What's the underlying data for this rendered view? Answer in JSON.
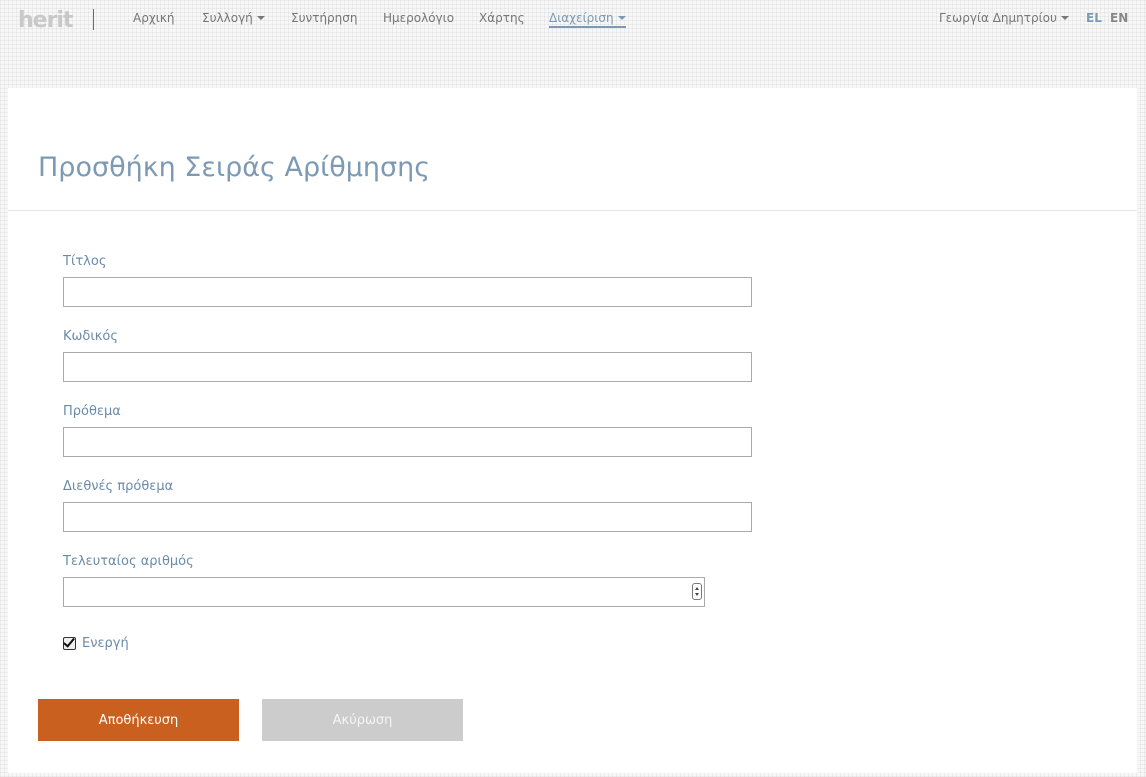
{
  "nav": {
    "logo_text": "herit",
    "items": [
      {
        "label": "Αρχική"
      },
      {
        "label": "Συλλογή"
      },
      {
        "label": "Συντήρηση"
      },
      {
        "label": "Ημερολόγιο"
      },
      {
        "label": "Χάρτης"
      },
      {
        "label": "Διαχείριση"
      }
    ],
    "active_item": "Διαχείριση",
    "user_name": "Γεωργία Δημητρίου",
    "languages": [
      "EL",
      "EN"
    ],
    "active_language": "EL"
  },
  "page": {
    "title": "Προσθήκη Σειράς Αρίθμησης"
  },
  "form": {
    "title_label": "Τίτλος",
    "title_value": "",
    "code_label": "Κωδικός",
    "code_value": "",
    "prefix_label": "Πρόθεμα",
    "prefix_value": "",
    "intl_prefix_label": "Διεθνές πρόθεμα",
    "intl_prefix_value": "",
    "last_number_label": "Τελευταίος αριθμός",
    "last_number_value": "",
    "active_label": "Ενεργή",
    "active_checked": true
  },
  "actions": {
    "save_label": "Αποθήκευση",
    "cancel_label": "Ακύρωση"
  },
  "colors": {
    "accent": "#7d9ab4",
    "save_button": "#c9601f",
    "cancel_button": "#cccccc"
  }
}
